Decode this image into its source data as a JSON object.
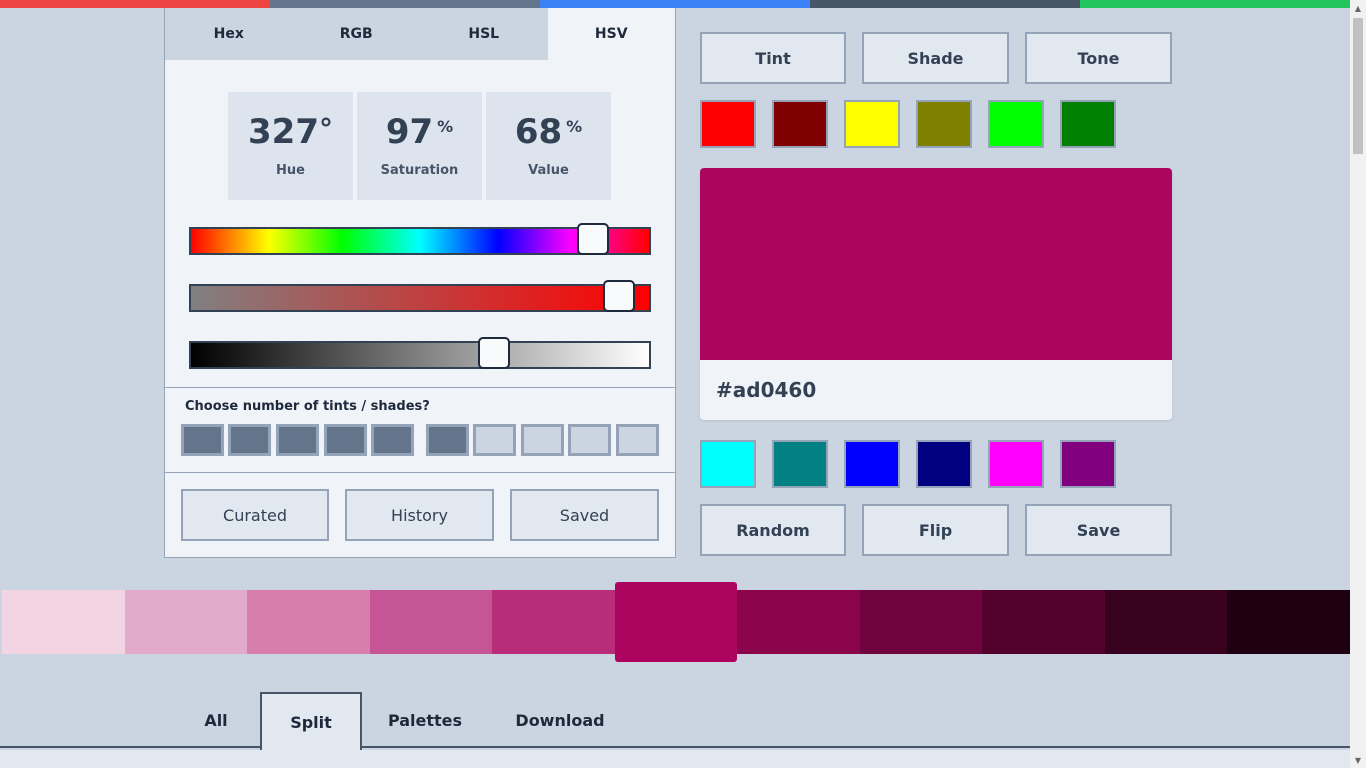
{
  "topbar_colors": [
    "#ef4444",
    "#64748b",
    "#3b82f6",
    "#475569",
    "#22c55e"
  ],
  "mode_tabs": [
    "Hex",
    "RGB",
    "HSL",
    "HSV"
  ],
  "active_mode_tab": "HSV",
  "readouts": {
    "hue": {
      "value": "327",
      "unit": "°",
      "label": "Hue"
    },
    "saturation": {
      "value": "97",
      "unit": "%",
      "label": "Saturation"
    },
    "value": {
      "value": "68",
      "unit": "%",
      "label": "Value"
    }
  },
  "sliders": {
    "hue_fraction": 0.878,
    "saturation_fraction": 0.934,
    "value_fraction": 0.662
  },
  "tints": {
    "question": "Choose number of tints / shades?",
    "total_boxes": 10,
    "selected_count": 6
  },
  "history_buttons": {
    "curated": "Curated",
    "history": "History",
    "saved": "Saved"
  },
  "modifier_buttons": {
    "tint": "Tint",
    "shade": "Shade",
    "tone": "Tone"
  },
  "top_swatches": [
    "#ff0000",
    "#800000",
    "#ffff00",
    "#808000",
    "#00ff00",
    "#008000"
  ],
  "preview": {
    "color": "#ad0460",
    "hex": "#ad0460"
  },
  "bottom_swatches": [
    "#00ffff",
    "#008080",
    "#0000ff",
    "#000080",
    "#ff00ff",
    "#800080"
  ],
  "action_buttons": {
    "random": "Random",
    "flip": "Flip",
    "save": "Save"
  },
  "strip": {
    "colors": [
      "#f3d4e3",
      "#e2aacb",
      "#d77ead",
      "#c55594",
      "#b92c7a",
      "#ad0460",
      "#8b044c",
      "#6f033e",
      "#53022e",
      "#38021f",
      "#1f0011"
    ],
    "selected_index": 5
  },
  "bottom_tabs": [
    "All",
    "Split",
    "Palettes",
    "Download"
  ],
  "active_bottom_tab": "Split"
}
